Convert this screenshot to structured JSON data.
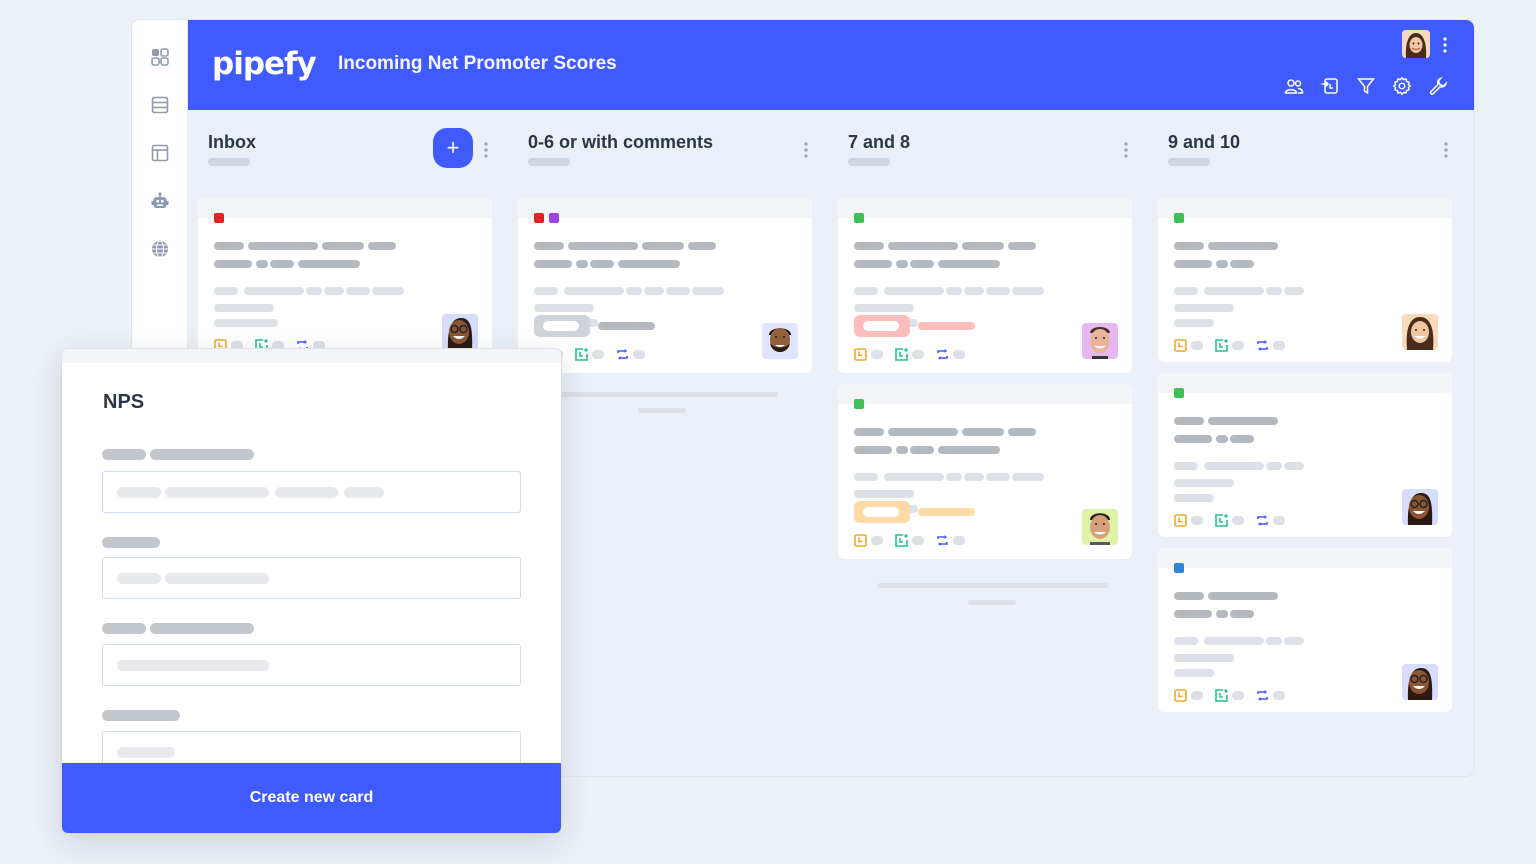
{
  "header": {
    "logo": "pipefy",
    "pipe_title": "Incoming Net Promoter Scores",
    "tools": [
      "members-icon",
      "import-icon",
      "filter-icon",
      "settings-icon",
      "wrench-icon"
    ]
  },
  "sidebar": {
    "items": [
      "apps-grid-icon",
      "database-icon",
      "layout-icon",
      "bot-icon",
      "globe-icon"
    ]
  },
  "columns": [
    {
      "title": "Inbox",
      "has_add": true,
      "add_label": "+"
    },
    {
      "title": "0-6 or with comments"
    },
    {
      "title": "7 and 8"
    },
    {
      "title": "9 and 10"
    }
  ],
  "colors": {
    "brand": "#3f5bfd",
    "label_red": "#e02424",
    "label_purple": "#9b45e4",
    "label_green": "#3fbf55",
    "label_blue": "#2f86d8",
    "tag_grey": "#cfd4db",
    "tag_red": "#ffbcbc",
    "tag_orange": "#ffd9a6",
    "icon_orange": "#f5a623",
    "icon_green": "#22c38e",
    "icon_blue": "#3f5bfd"
  },
  "modal": {
    "title": "NPS",
    "create_button": "Create new card"
  }
}
